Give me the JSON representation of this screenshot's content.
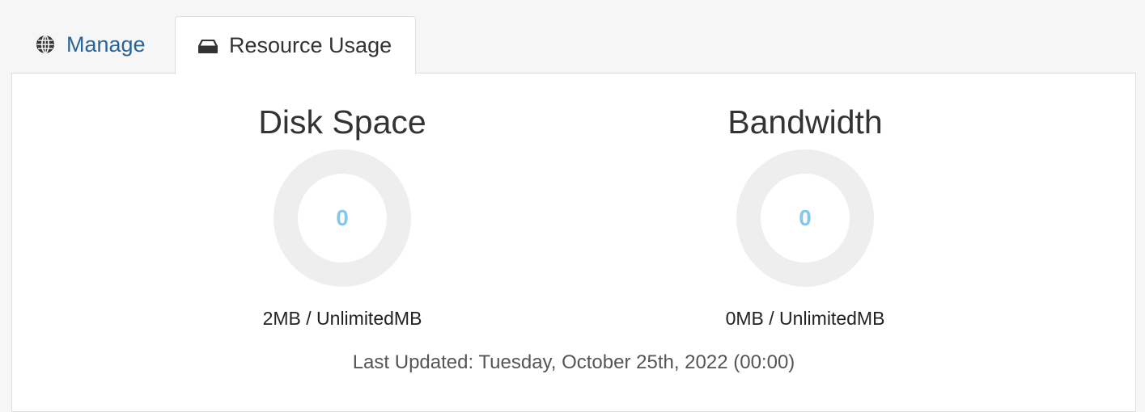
{
  "tabs": [
    {
      "label": "Manage",
      "icon": "globe-icon",
      "active": false
    },
    {
      "label": "Resource Usage",
      "icon": "hdd-icon",
      "active": true
    }
  ],
  "disk": {
    "title": "Disk Space",
    "value": "0",
    "percent_used": 0,
    "amount": "2MB / UnlimitedMB"
  },
  "bandwidth": {
    "title": "Bandwidth",
    "value": "0",
    "percent_used": 0,
    "amount": "0MB / UnlimitedMB"
  },
  "last_updated": "Last Updated: Tuesday, October 25th, 2022 (00:00)",
  "colors": {
    "gauge_track": "#eeeeee",
    "gauge_value": "#87c6ea",
    "link": "#2a6496"
  }
}
